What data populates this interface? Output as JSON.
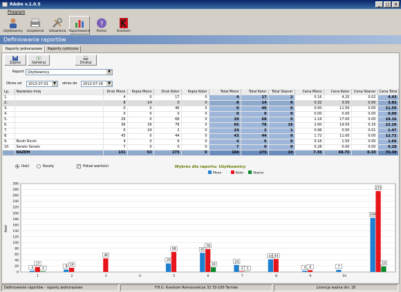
{
  "window": {
    "title": "RAdm v.1.0.5"
  },
  "menu": {
    "program": "Program"
  },
  "toolbar": [
    {
      "label": "Użytkownicy",
      "icon": "users-icon"
    },
    {
      "label": "Urządzenia",
      "icon": "devices-icon"
    },
    {
      "label": "Ustawienia",
      "icon": "settings-icon"
    },
    {
      "label": "Raportowanie",
      "icon": "report-icon"
    },
    {
      "label": "Pomoc",
      "icon": "help-icon"
    },
    {
      "label": "Kserkom",
      "icon": "kserkom-logo-icon"
    }
  ],
  "header": {
    "title": "Definiowanie raportów"
  },
  "tabs": [
    "Raporty jednorazowe",
    "Raporty cykliczne"
  ],
  "actions": {
    "save": "Zapisz",
    "generate": "Generuj",
    "print": "Drukuj"
  },
  "filters": {
    "report_label": "Raport",
    "report_value": "Użytkownicy",
    "from_label": "Okres od",
    "from_value": "2013-07-01",
    "to_label": "okres do",
    "to_value": "2013-07-16"
  },
  "table": {
    "headers": [
      "Lp.",
      "Nazwisko Imię",
      "Druk Mono",
      "Kopia Mono",
      "Druk Kolor",
      "Kopia Kolor",
      "Total Mono",
      "Total Kolor",
      "Total Skaner",
      "Cena Mono",
      "Cena Kolor",
      "Cena Skaner",
      "Cena Total"
    ],
    "rows": [
      [
        "1.",
        "",
        "4",
        "0",
        "17",
        "0",
        "4",
        "17",
        "2",
        "0.16",
        "4.25",
        "0.02",
        "4.43"
      ],
      [
        "2.",
        "",
        "8",
        "14",
        "0",
        "0",
        "8",
        "14",
        "0",
        "0.32",
        "3.50",
        "0.00",
        "3.82"
      ],
      [
        "3.",
        "",
        "0",
        "0",
        "46",
        "0",
        "0",
        "46",
        "0",
        "0.00",
        "11.50",
        "0.00",
        "11.50"
      ],
      [
        "4.",
        "",
        "0",
        "0",
        "0",
        "0",
        "0",
        "0",
        "0",
        "0.00",
        "0.00",
        "0.00",
        "0.00"
      ],
      [
        "5.",
        "",
        "29",
        "0",
        "68",
        "0",
        "29",
        "68",
        "0",
        "1.16",
        "17.00",
        "0.00",
        "18.16"
      ],
      [
        "6.",
        "",
        "36",
        "29",
        "78",
        "0",
        "65",
        "78",
        "16",
        "2.60",
        "19.50",
        "0.16",
        "22.26"
      ],
      [
        "7.",
        "",
        "0",
        "24",
        "2",
        "0",
        "24",
        "2",
        "1",
        "0.96",
        "0.50",
        "0.01",
        "1.47"
      ],
      [
        "8.",
        "",
        "43",
        "0",
        "44",
        "0",
        "43",
        "44",
        "0",
        "1.72",
        "11.00",
        "0.00",
        "12.72"
      ],
      [
        "9.",
        "Ricoh Ricoh",
        "4",
        "0",
        "6",
        "0",
        "4",
        "6",
        "0",
        "0.16",
        "1.50",
        "0.00",
        "1.66"
      ],
      [
        "10.",
        "Serwis Serwis",
        "7",
        "0",
        "0",
        "0",
        "7",
        "0",
        "0",
        "0.28",
        "0.00",
        "0.00",
        "0.28"
      ]
    ],
    "total": [
      "",
      "RAZEM",
      "131",
      "53",
      "275",
      "0",
      "184",
      "275",
      "19",
      "7.36",
      "68.75",
      "0.19",
      "76.30"
    ]
  },
  "options": {
    "ilosc": "Ilość",
    "koszty": "Koszty",
    "show_values": "Pokaż wartości"
  },
  "colors": {
    "mono": "#1e7fd0",
    "kolor": "#e8141b",
    "skaner": "#0a8a2a",
    "title": "#6b7a00"
  },
  "chart_data": {
    "type": "bar",
    "title": "Wykres dla raportu: Użytkownicy",
    "ylabel": "Ilość",
    "ylim": [
      0,
      300
    ],
    "yticks": [
      0,
      20,
      40,
      60,
      80,
      100,
      120,
      140,
      160,
      180,
      200,
      220,
      240,
      260,
      280,
      300
    ],
    "categories": [
      "1",
      "2",
      "3",
      "4",
      "5",
      "6",
      "7",
      "8",
      "9",
      "10",
      ""
    ],
    "series": [
      {
        "name": "Mono",
        "values": [
          4,
          8,
          0,
          0,
          29,
          65,
          24,
          43,
          4,
          7,
          184
        ]
      },
      {
        "name": "Kolor",
        "values": [
          17,
          14,
          46,
          0,
          68,
          78,
          2,
          44,
          6,
          0,
          275
        ]
      },
      {
        "name": "Skaner",
        "values": [
          2,
          0,
          0,
          0,
          0,
          16,
          1,
          0,
          0,
          0,
          19
        ]
      }
    ],
    "legend": "top-center",
    "grid": true
  },
  "status": {
    "left": "Definiowanie raportów - raporty jednorazowe",
    "middle": "F.H.U. Kserkom  Romanowicza 32 33-100 Tarnów",
    "right": "Licencja ważna dni: 25"
  }
}
